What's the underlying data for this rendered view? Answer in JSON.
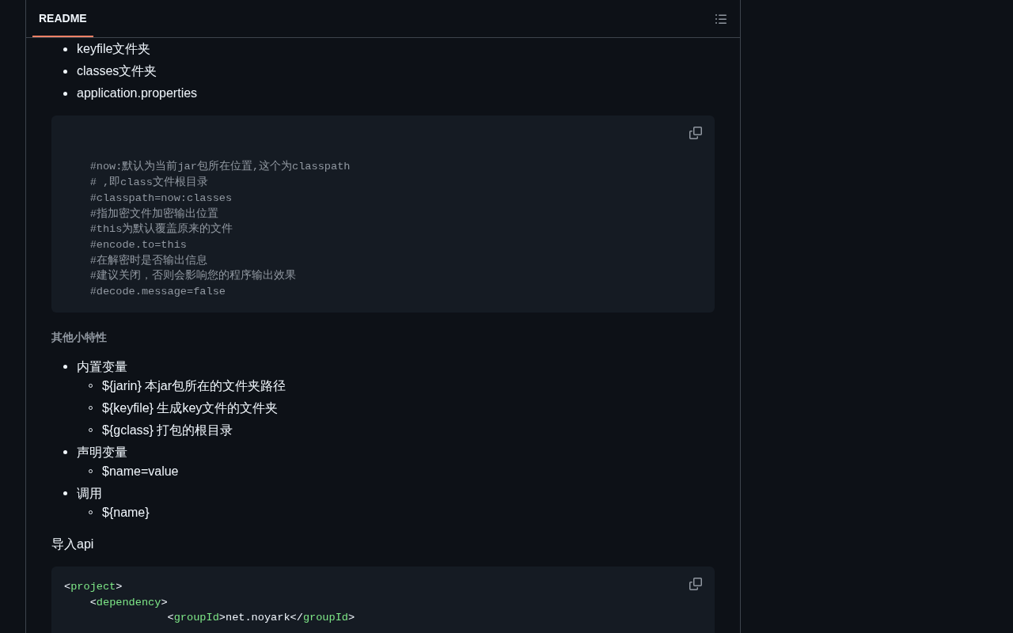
{
  "readme": {
    "tab": {
      "label": "README",
      "selected": true
    },
    "blocks": [
      {
        "kind": "list",
        "items": [
          {
            "text": "keyfile文件夹"
          },
          {
            "text": "classes文件夹"
          },
          {
            "text": "application.properties"
          }
        ]
      },
      {
        "kind": "code",
        "code": "\n\n    #now:默认为当前jar包所在位置,这个为classpath\n    # ,即class文件根目录\n    #classpath=now:classes\n    #指加密文件加密输出位置\n    #this为默认覆盖原来的文件\n    #encode.to=this\n    #在解密时是否输出信息\n    #建议关闭，否则会影响您的程序输出效果\n    #decode.message=false"
      },
      {
        "kind": "heading",
        "text": "其他小特性"
      },
      {
        "kind": "list",
        "items": [
          {
            "text": "内置变量",
            "children": [
              {
                "text": "${jarin} 本jar包所在的文件夹路径"
              },
              {
                "text": "${keyfile} 生成key文件的文件夹"
              },
              {
                "text": "${gclass} 打包的根目录"
              }
            ]
          },
          {
            "text": "声明变量",
            "children": [
              {
                "text": "$name=value"
              }
            ]
          },
          {
            "text": "调用",
            "children": [
              {
                "text": "${name}"
              }
            ]
          }
        ]
      },
      {
        "kind": "paragraph",
        "text": "导入api"
      },
      {
        "kind": "code",
        "code": "<project>\n    <dependency>\n                <groupId>net.noyark</groupId>"
      }
    ]
  }
}
